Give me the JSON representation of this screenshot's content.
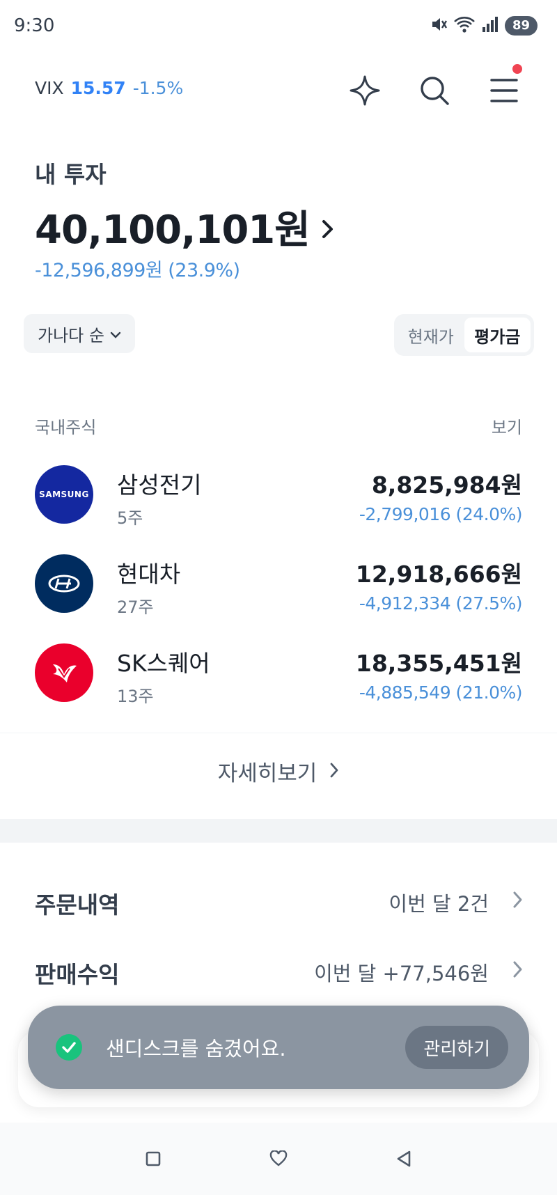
{
  "status_bar": {
    "time": "9:30",
    "battery": "89"
  },
  "header": {
    "vix_label": "VIX",
    "vix_value": "15.57",
    "vix_change": "-1.5%"
  },
  "investment": {
    "title": "내 투자",
    "total": "40,100,101원",
    "change": "-12,596,899원 (23.9%)"
  },
  "controls": {
    "sort_label": "가나다 순",
    "toggle": [
      "현재가",
      "평가금"
    ],
    "toggle_active": "평가금"
  },
  "section": {
    "label": "국내주식",
    "link": "보기"
  },
  "stocks": [
    {
      "name": "삼성전기",
      "qty": "5주",
      "value": "8,825,984원",
      "change": "-2,799,016 (24.0%)",
      "logo_text": "SAMSUNG",
      "logo_color": "#1428a0"
    },
    {
      "name": "현대차",
      "qty": "27주",
      "value": "12,918,666원",
      "change": "-4,912,334 (27.5%)",
      "logo_text": "",
      "logo_color": "#002c5f"
    },
    {
      "name": "SK스퀘어",
      "qty": "13주",
      "value": "18,355,451원",
      "change": "-4,885,549 (21.0%)",
      "logo_text": "",
      "logo_color": "#ea002c"
    }
  ],
  "more_label": "자세히보기",
  "menu": [
    {
      "title": "주문내역",
      "value": "이번 달 2건"
    },
    {
      "title": "판매수익",
      "value": "이번 달 +77,546원"
    }
  ],
  "toast": {
    "message": "샌디스크를 숨겼어요.",
    "action": "관리하기"
  },
  "colors": {
    "accent": "#3182f6",
    "loss": "#4a90d9",
    "toast_bg": "#8b95a1",
    "check": "#19c37d"
  }
}
